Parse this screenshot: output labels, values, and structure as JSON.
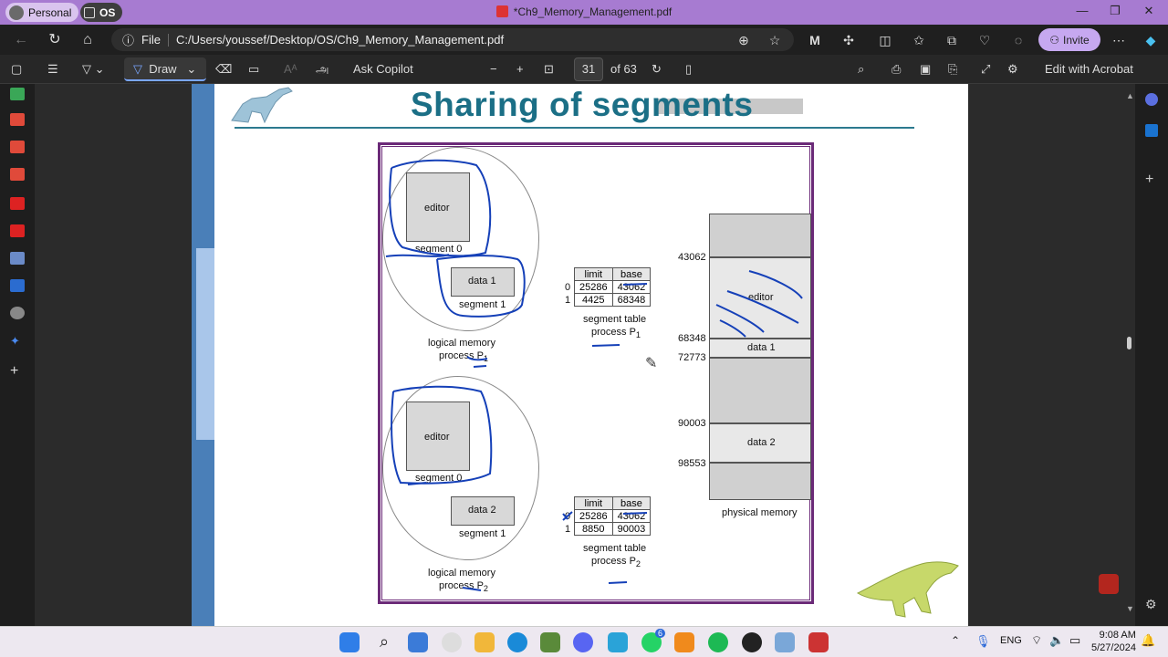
{
  "window": {
    "profile_label": "Personal",
    "workspace_label": "OS",
    "title": "*Ch9_Memory_Management.pdf",
    "minimize": "—",
    "maximize": "❐",
    "close": "✕"
  },
  "address_bar": {
    "file_label": "File",
    "url": "C:/Users/youssef/Desktop/OS/Ch9_Memory_Management.pdf",
    "invite_label": "Invite"
  },
  "pdf_toolbar": {
    "draw_label": "Draw",
    "read_aloud_glyph": "அ",
    "ask_copilot_label": "Ask Copilot",
    "current_page": "31",
    "page_total": "of 63",
    "edit_acrobat_label": "Edit with Acrobat"
  },
  "slide": {
    "title": "Sharing of segments",
    "figure": {
      "p1": {
        "editor_label": "editor",
        "segment0_label": "segment 0",
        "data_label": "data 1",
        "segment1_label": "segment 1",
        "logical_memory_label": "logical memory",
        "process_label": "process P",
        "process_sub": "1",
        "table_headers": [
          "limit",
          "base"
        ],
        "table_rows": [
          {
            "idx": "0",
            "limit": "25286",
            "base": "43062"
          },
          {
            "idx": "1",
            "limit": "4425",
            "base": "68348"
          }
        ],
        "table_caption": "segment table",
        "table_process": "process P",
        "table_process_sub": "1"
      },
      "p2": {
        "editor_label": "editor",
        "segment0_label": "segment 0",
        "data_label": "data 2",
        "segment1_label": "segment 1",
        "logical_memory_label": "logical memory",
        "process_label": "process P",
        "process_sub": "2",
        "table_headers": [
          "limit",
          "base"
        ],
        "table_rows": [
          {
            "idx": "0",
            "limit": "25286",
            "base": "43062"
          },
          {
            "idx": "1",
            "limit": "8850",
            "base": "90003"
          }
        ],
        "table_caption": "segment table",
        "table_process": "process P",
        "table_process_sub": "2"
      },
      "physical_memory": {
        "addresses": [
          "43062",
          "68348",
          "72773",
          "90003",
          "98553"
        ],
        "editor_label": "editor",
        "data1_label": "data 1",
        "data2_label": "data 2",
        "caption": "physical memory"
      }
    }
  },
  "taskbar": {
    "language": "ENG",
    "time": "9:08 AM",
    "date": "5/27/2024",
    "whatsapp_badge": "6"
  },
  "colors": {
    "titlebar": "#a77bd1",
    "slide_title": "#1b6f86",
    "figure_border": "#6b2a78",
    "ink": "#1540b8"
  }
}
